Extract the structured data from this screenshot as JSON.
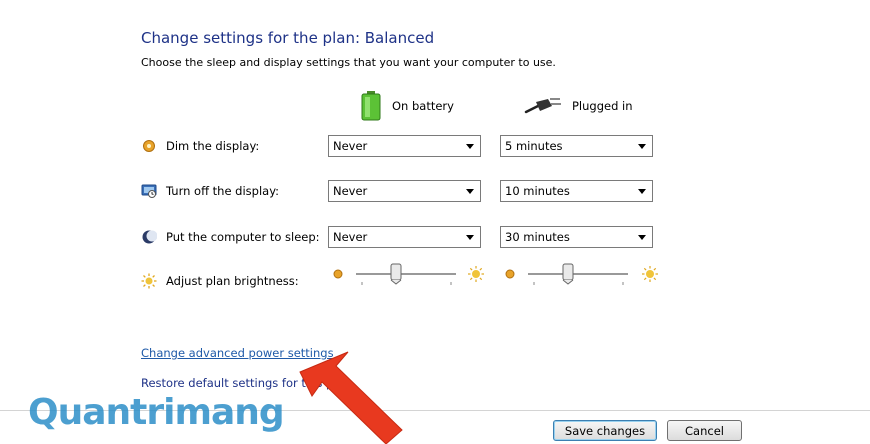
{
  "header": {
    "title": "Change settings for the plan: Balanced",
    "subtitle": "Choose the sleep and display settings that you want your computer to use."
  },
  "columns": {
    "battery": {
      "label": "On battery",
      "icon": "battery-icon"
    },
    "plugged": {
      "label": "Plugged in",
      "icon": "power-plug-icon"
    }
  },
  "rows": [
    {
      "label": "Dim the display:",
      "icon": "dim-display-icon",
      "battery": "Never",
      "plugged": "5 minutes"
    },
    {
      "label": "Turn off the display:",
      "icon": "monitor-icon",
      "battery": "Never",
      "plugged": "10 minutes"
    },
    {
      "label": "Put the computer to sleep:",
      "icon": "moon-icon",
      "battery": "Never",
      "plugged": "30 minutes"
    }
  ],
  "brightness": {
    "label": "Adjust plan brightness:",
    "battery_level": 0.4,
    "plugged_level": 0.4
  },
  "links": {
    "advanced": "Change advanced power settings",
    "restore": "Restore default settings for this plan"
  },
  "buttons": {
    "save": "Save changes",
    "cancel": "Cancel"
  },
  "watermark": {
    "text": "Quantrimang"
  },
  "colors": {
    "title": "#1e3287",
    "link": "#1f5aa8",
    "arrow": "#e8391f"
  }
}
